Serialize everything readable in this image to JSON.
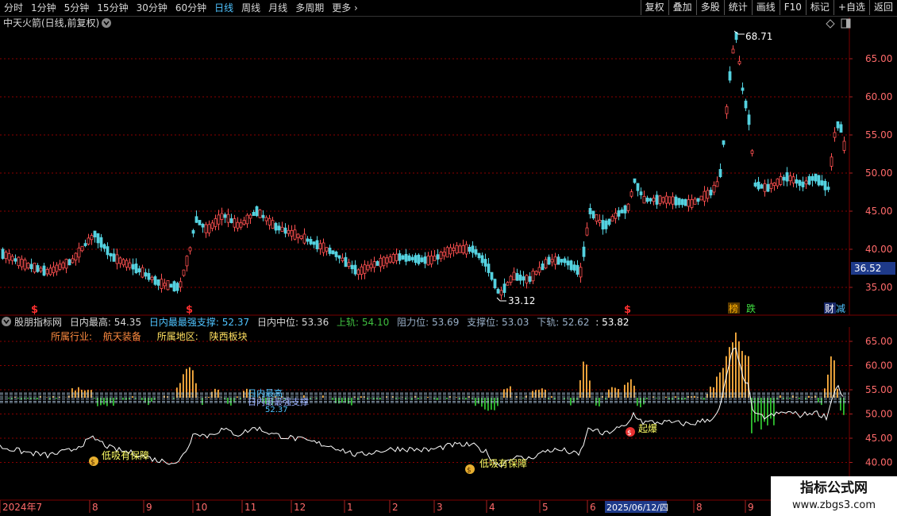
{
  "toolbar": {
    "periods": [
      "分时",
      "1分钟",
      "5分钟",
      "15分钟",
      "30分钟",
      "60分钟",
      "日线",
      "周线",
      "月线",
      "多周期",
      "更多"
    ],
    "active_period": "日线",
    "actions": [
      "复权",
      "叠加",
      "多股",
      "统计",
      "画线",
      "F10",
      "标记",
      "+自选",
      "返回"
    ]
  },
  "main_panel": {
    "title": "中天火箭(日线,前复权)",
    "y_ticks": [
      "65.00",
      "60.00",
      "55.00",
      "50.00",
      "45.00",
      "40.00",
      "35.00"
    ],
    "current_price": "36.52",
    "high_label": "68.71",
    "low_label": "33.12",
    "markers": [
      "$",
      "$",
      "$"
    ],
    "tags": [
      "榜",
      "跌",
      "财",
      "减"
    ]
  },
  "indicator_panel": {
    "name": "股朋指标网",
    "readouts": [
      {
        "label": "日内最高:",
        "value": "54.35"
      },
      {
        "label": "日内最最强支撑:",
        "value": "52.37"
      },
      {
        "label": "日内中位:",
        "value": "53.36"
      },
      {
        "label": "上轨:",
        "value": "54.10"
      },
      {
        "label": "阻力位:",
        "value": "53.69"
      },
      {
        "label": "支撑位:",
        "value": "53.03"
      },
      {
        "label": "下轨:",
        "value": "52.62"
      },
      {
        "label": ":",
        "value": "53.82"
      }
    ],
    "industry_label": "所属行业:",
    "industry": "航天装备",
    "region_label": "所属地区:",
    "region": "陕西板块",
    "y_ticks": [
      "65.00",
      "60.00",
      "55.00",
      "50.00",
      "45.00",
      "40.00"
    ],
    "signals": [
      "低吸有保障",
      "低吸有保障",
      "起爆"
    ],
    "overlap_labels": [
      "日内最高",
      "日内最最强支撑",
      "52.37"
    ]
  },
  "time_axis": {
    "labels": [
      "2024年7",
      "8",
      "9",
      "10",
      "11",
      "12",
      "1",
      "2",
      "3",
      "4",
      "5",
      "6",
      "8",
      "9"
    ],
    "cursor_date": "2025/06/12/四"
  },
  "watermark": {
    "title": "指标公式网",
    "url": "www.zbgs3.com"
  },
  "colors": {
    "up": "#ff5050",
    "down": "#54d2e0",
    "grid": "#8b0000",
    "axis_text": "#ff6a6a",
    "accent": "#4fc3ff",
    "band": "#a8c0d8",
    "signal_text": "#ffff66"
  }
}
